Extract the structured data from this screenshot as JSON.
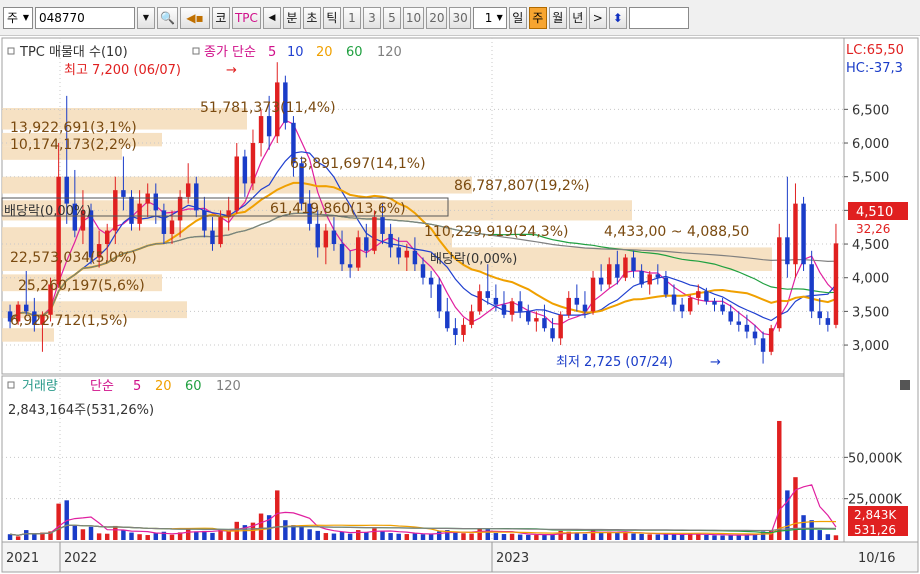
{
  "toolbar": {
    "market_label": "주",
    "code_value": "048770",
    "item_label": "코",
    "name_label": "TPC",
    "unit_label": "분",
    "seconds_label": "초",
    "tick_label": "틱",
    "periods": [
      "1",
      "3",
      "5",
      "10",
      "20",
      "30"
    ],
    "count_value": "1",
    "day_label": "일",
    "week_label": "주",
    "month_label": "월",
    "year_label": "년",
    "next_label": ">"
  },
  "price_panel": {
    "legend_title": "TPC 매물대 수(10)",
    "legend_ma": "종가 단순",
    "ma_periods": [
      "5",
      "10",
      "20",
      "60",
      "120"
    ],
    "lc_label": "LC:65,50",
    "hc_label": "HC:-37,3",
    "current_price": "4,510",
    "current_change": "32,26",
    "high_label": "최고 7,200 (06/07)",
    "low_label": "최저 2,725 (07/24)",
    "dividend_labels": [
      "배당락(0,00%)",
      "배당락(0,00%)"
    ],
    "volume_profile": [
      "51,781,373(11,4%)",
      "13,922,691(3,1%)",
      "10,174,173(2,2%)",
      "63,891,697(14,1%)",
      "86,787,807(19,2%)",
      "61,419,860(13,6%)",
      "110,229,919(24,3%)",
      "22,573,034(5,0%)",
      "25,260,197(5,6%)",
      "6,922,712(1,5%)"
    ],
    "range_label": "4,433,00 ~ 4,088,50"
  },
  "volume_panel": {
    "legend_title": "거래량",
    "legend_ma": "단순",
    "ma_periods": [
      "5",
      "20",
      "60",
      "120"
    ],
    "summary": "2,843,164주(531,26%)",
    "current_volume": "2,843K",
    "current_pct": "531,26"
  },
  "x_axis": {
    "labels": [
      "2021",
      "2022",
      "2023"
    ],
    "last_date": "10/16"
  },
  "colors": {
    "up": "#e02020",
    "down": "#1a3cc8",
    "ma5": "#e020a0",
    "ma10": "#2040d0",
    "ma20": "#f0a000",
    "ma60": "#20a040",
    "ma120": "#808080",
    "profile": "#f5dcb8",
    "grid": "#c8c8c8"
  },
  "chart_data": {
    "type": "candlestick",
    "price_axis": {
      "ticks": [
        3000,
        3500,
        4000,
        4500,
        5000,
        5500,
        6000,
        6500
      ],
      "tick_labels": [
        "3,000",
        "3,500",
        "4,000",
        "4,500",
        "5,000",
        "5,500",
        "6,000",
        "6,500"
      ],
      "ylim": [
        2600,
        7500
      ]
    },
    "volume_axis": {
      "ticks": [
        25000,
        50000
      ],
      "tick_labels": [
        "25,000K",
        "50,000K"
      ],
      "ylim": [
        0,
        75000
      ]
    },
    "candles": [
      [
        3500,
        3600,
        3250,
        3350,
        3500
      ],
      [
        3350,
        3650,
        3300,
        3600,
        2200
      ],
      [
        3600,
        4100,
        3450,
        3500,
        6000
      ],
      [
        3500,
        3700,
        3200,
        3300,
        3400
      ],
      [
        3300,
        3500,
        2900,
        3450,
        4500
      ],
      [
        3450,
        4000,
        3350,
        3900,
        5200
      ],
      [
        3900,
        6000,
        3850,
        5500,
        22000
      ],
      [
        5500,
        6700,
        4800,
        5100,
        24000
      ],
      [
        5100,
        5600,
        4600,
        4700,
        9000
      ],
      [
        4700,
        5300,
        4500,
        5000,
        6500
      ],
      [
        5000,
        5100,
        4200,
        4300,
        8000
      ],
      [
        4300,
        4700,
        4150,
        4500,
        4000
      ],
      [
        4500,
        4800,
        4250,
        4700,
        3800
      ],
      [
        4700,
        5500,
        4500,
        5300,
        8500
      ],
      [
        5300,
        5800,
        5000,
        5200,
        6000
      ],
      [
        5200,
        5300,
        4700,
        4800,
        4500
      ],
      [
        4800,
        5300,
        4700,
        5100,
        3500
      ],
      [
        5100,
        5400,
        4900,
        5250,
        3000
      ],
      [
        5250,
        5400,
        4800,
        5000,
        4200
      ],
      [
        5000,
        5100,
        4500,
        4650,
        5000
      ],
      [
        4650,
        5000,
        4500,
        4850,
        3200
      ],
      [
        4850,
        5300,
        4600,
        5200,
        4600
      ],
      [
        5200,
        5700,
        5100,
        5400,
        6800
      ],
      [
        5400,
        5500,
        4900,
        5000,
        5200
      ],
      [
        5000,
        5200,
        4600,
        4700,
        5500
      ],
      [
        4700,
        4900,
        4400,
        4500,
        4300
      ],
      [
        4500,
        5000,
        4450,
        4900,
        6200
      ],
      [
        4900,
        5200,
        4700,
        5000,
        5800
      ],
      [
        5000,
        6000,
        4950,
        5800,
        11000
      ],
      [
        5800,
        5900,
        5200,
        5400,
        9000
      ],
      [
        5400,
        6200,
        5300,
        6000,
        10500
      ],
      [
        6000,
        6500,
        5800,
        6400,
        16000
      ],
      [
        6400,
        6700,
        5900,
        6100,
        15000
      ],
      [
        6100,
        7200,
        6000,
        6900,
        30000
      ],
      [
        6900,
        7000,
        6200,
        6300,
        12000
      ],
      [
        6300,
        6400,
        5500,
        5700,
        9000
      ],
      [
        5700,
        5800,
        5000,
        5100,
        8000
      ],
      [
        5100,
        5300,
        4700,
        4800,
        6500
      ],
      [
        4800,
        5000,
        4300,
        4450,
        5500
      ],
      [
        4450,
        4800,
        4200,
        4700,
        4200
      ],
      [
        4700,
        4900,
        4400,
        4500,
        3900
      ],
      [
        4500,
        4700,
        4100,
        4200,
        5000
      ],
      [
        4200,
        4400,
        4000,
        4150,
        3800
      ],
      [
        4150,
        4700,
        4100,
        4600,
        6000
      ],
      [
        4600,
        4800,
        4300,
        4400,
        4600
      ],
      [
        4400,
        5000,
        4350,
        4900,
        7000
      ],
      [
        4900,
        5100,
        4500,
        4650,
        5400
      ],
      [
        4650,
        4800,
        4300,
        4450,
        4200
      ],
      [
        4450,
        4600,
        4200,
        4300,
        3800
      ],
      [
        4300,
        4500,
        4100,
        4400,
        3600
      ],
      [
        4400,
        4600,
        4100,
        4200,
        3900
      ],
      [
        4200,
        4300,
        3900,
        4000,
        3500
      ],
      [
        4000,
        4100,
        3700,
        3900,
        3400
      ],
      [
        3900,
        4000,
        3400,
        3500,
        5200
      ],
      [
        3500,
        3700,
        3200,
        3250,
        6000
      ],
      [
        3250,
        3400,
        3000,
        3150,
        4800
      ],
      [
        3150,
        3400,
        3050,
        3300,
        4100
      ],
      [
        3300,
        3600,
        3250,
        3500,
        3900
      ],
      [
        3500,
        3900,
        3450,
        3800,
        7200
      ],
      [
        3800,
        4200,
        3600,
        3700,
        6500
      ],
      [
        3700,
        3900,
        3500,
        3600,
        4200
      ],
      [
        3600,
        3800,
        3400,
        3450,
        3600
      ],
      [
        3450,
        3700,
        3350,
        3650,
        3800
      ],
      [
        3650,
        3800,
        3400,
        3500,
        3300
      ],
      [
        3500,
        3600,
        3300,
        3350,
        3100
      ],
      [
        3350,
        3500,
        3200,
        3400,
        3000
      ],
      [
        3400,
        3600,
        3200,
        3250,
        3200
      ],
      [
        3250,
        3400,
        3050,
        3100,
        3600
      ],
      [
        3100,
        3500,
        3000,
        3450,
        5500
      ],
      [
        3450,
        3800,
        3400,
        3700,
        5000
      ],
      [
        3700,
        3900,
        3500,
        3600,
        4100
      ],
      [
        3600,
        3800,
        3400,
        3500,
        3700
      ],
      [
        3500,
        4100,
        3450,
        4000,
        6200
      ],
      [
        4000,
        4200,
        3800,
        3900,
        4600
      ],
      [
        3900,
        4300,
        3850,
        4200,
        5100
      ],
      [
        4200,
        4400,
        3900,
        4000,
        4300
      ],
      [
        4000,
        4350,
        3950,
        4300,
        4800
      ],
      [
        4300,
        4400,
        4000,
        4100,
        3900
      ],
      [
        4100,
        4200,
        3850,
        3900,
        3700
      ],
      [
        3900,
        4100,
        3750,
        4050,
        3400
      ],
      [
        4050,
        4200,
        3900,
        4000,
        3300
      ],
      [
        4000,
        4100,
        3700,
        3750,
        3600
      ],
      [
        3750,
        3900,
        3500,
        3600,
        3500
      ],
      [
        3600,
        3700,
        3400,
        3500,
        3200
      ],
      [
        3500,
        3750,
        3450,
        3700,
        3900
      ],
      [
        3700,
        3900,
        3600,
        3800,
        3400
      ],
      [
        3800,
        3850,
        3600,
        3650,
        3100
      ],
      [
        3650,
        3700,
        3500,
        3600,
        2800
      ],
      [
        3600,
        3700,
        3450,
        3500,
        2700
      ],
      [
        3500,
        3600,
        3300,
        3350,
        3000
      ],
      [
        3350,
        3500,
        3200,
        3300,
        3200
      ],
      [
        3300,
        3450,
        3100,
        3200,
        3400
      ],
      [
        3200,
        3300,
        3000,
        3100,
        3600
      ],
      [
        3100,
        3200,
        2725,
        2900,
        5200
      ],
      [
        2900,
        3300,
        2850,
        3250,
        6000
      ],
      [
        3250,
        4800,
        3200,
        4600,
        72000
      ],
      [
        4600,
        5500,
        4000,
        4200,
        30000
      ],
      [
        4200,
        5400,
        4000,
        5100,
        38000
      ],
      [
        5100,
        5200,
        4100,
        4200,
        15000
      ],
      [
        4200,
        4400,
        3400,
        3500,
        12000
      ],
      [
        3500,
        3700,
        3300,
        3400,
        6000
      ],
      [
        3400,
        3500,
        3200,
        3300,
        3500
      ],
      [
        3300,
        4800,
        3250,
        4510,
        2843
      ]
    ]
  }
}
